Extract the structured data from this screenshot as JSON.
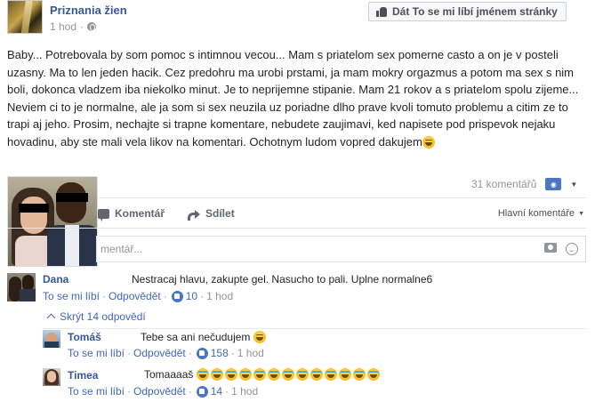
{
  "header": {
    "page_name": "Priznania žien",
    "time": "1 hod",
    "like_page_button": "Dát To se mi líbí jménem stránky"
  },
  "post": {
    "text": "Baby... Potrebovala by som pomoc s intimnou vecou... Mam s priatelom sex pomerne casto a on je v posteli uzasny. Ma to len jeden hacik. Cez predohru ma urobi prstami, ja mam mokry orgazmus a potom ma sex s nim boli, dokonca vladzem iba niekolko minut. Je to neprijemne stipanie. Mam 21 rokov a s priatelom spolu zijeme... Neviem ci to je normalne, ale ja som si sex neuzila uz poriadne dlho prave kvoli tomuto problemu a citim ze to trapi aj jeho. Prosim, nechajte si trapne komentare, nebudete zaujimavi, ked napisete pod prispevok nejaku hovadinu, aby ste mali vela likov na komentari. Ochotnym ludom vopred dakujem",
    "comment_count": "31 komentářů"
  },
  "actions": {
    "comment": "Komentář",
    "share": "Sdílet",
    "sort": "Hlavní komentáře"
  },
  "comment_box": {
    "placeholder": "mentář..."
  },
  "comments": [
    {
      "name": "Dana",
      "text": "Nestracaj hlavu, zakupte gel. Nasucho to pali. Uplne normalne6",
      "like": "To se mi líbí",
      "reply": "Odpovědět",
      "likes": "10",
      "time": "1 hod"
    }
  ],
  "replies_toggle": "Skrýt 14 odpovědí",
  "replies": [
    {
      "name": "Tomáš",
      "text": "Tebe sa ani nečudujem",
      "like": "To se mi líbí",
      "reply": "Odpovědět",
      "likes": "158",
      "time": "1 hod"
    },
    {
      "name": "Timea",
      "text": "Tomaaaaš",
      "like": "To se mi líbí",
      "reply": "Odpovědět",
      "likes": "14",
      "time": "1 hod"
    }
  ],
  "icons": {
    "page_avatar": "page-avatar-image",
    "globe": "globe-icon",
    "thumb": "thumb-up-icon",
    "share_badge": "share-count-icon",
    "camera": "camera-icon",
    "smile": "emoji-icon"
  },
  "colors": {
    "link_blue": "#365899",
    "action_blue": "#4267b2",
    "like_badge": "#4a76c2",
    "muted": "#90949c"
  }
}
